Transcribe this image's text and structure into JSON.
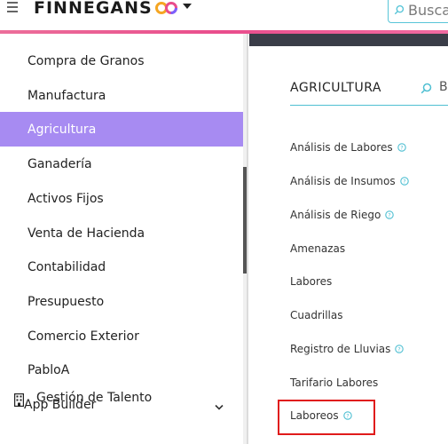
{
  "header": {
    "brand": "FINNEGANS",
    "search_placeholder": "Busca"
  },
  "colors": {
    "accent_bar": "#e94d8c",
    "active_item": "#a78bf2",
    "search_border": "#58c5d8",
    "highlight": "#e01b1b",
    "panel_strip": "#3a3d48"
  },
  "sidebar": {
    "items": [
      {
        "label": "Compra de Granos",
        "active": false
      },
      {
        "label": "Manufactura",
        "active": false
      },
      {
        "label": "Agricultura",
        "active": true
      },
      {
        "label": "Ganadería",
        "active": false
      },
      {
        "label": "Activos Fijos",
        "active": false
      },
      {
        "label": "Venta de Hacienda",
        "active": false
      },
      {
        "label": "Contabilidad",
        "active": false
      },
      {
        "label": "Presupuesto",
        "active": false
      },
      {
        "label": "Comercio Exterior",
        "active": false
      },
      {
        "label": "PabloA",
        "active": false
      }
    ],
    "section_label": "App Builder",
    "talent_label": "Gestión de Talento"
  },
  "panel": {
    "title": "AGRICULTURA",
    "search_text": "B",
    "entries": [
      {
        "label": "Análisis de Labores",
        "help": true
      },
      {
        "label": "Análisis de Insumos",
        "help": true
      },
      {
        "label": "Análisis de Riego",
        "help": true
      },
      {
        "label": "Amenazas",
        "help": false
      },
      {
        "label": "Labores",
        "help": false
      },
      {
        "label": "Cuadrillas",
        "help": false
      },
      {
        "label": "Registro de Lluvias",
        "help": true
      },
      {
        "label": "Tarifario Labores",
        "help": false
      },
      {
        "label": "Laboreos",
        "help": true
      }
    ]
  }
}
